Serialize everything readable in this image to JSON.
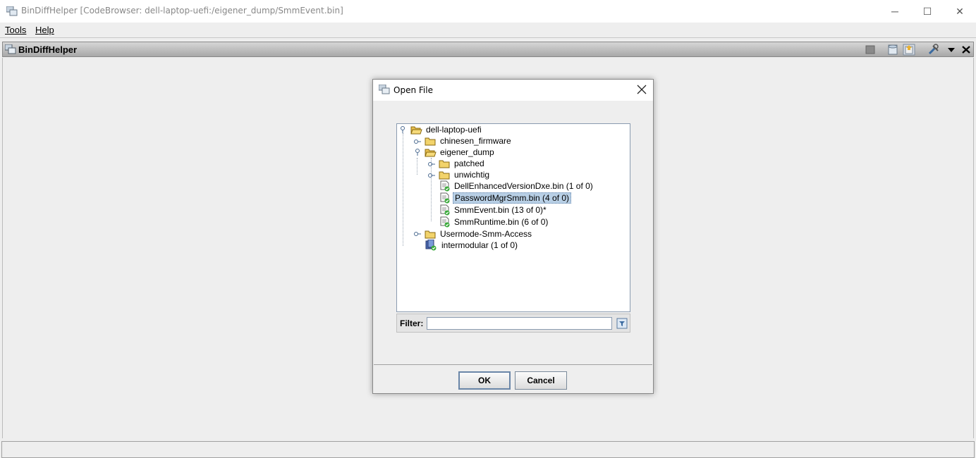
{
  "window": {
    "title": "BinDiffHelper [CodeBrowser: dell-laptop-uefi:/eigener_dump/SmmEvent.bin]",
    "controls": {
      "minimize": "─",
      "maximize": "☐",
      "close": "✕"
    }
  },
  "menubar": {
    "items": [
      {
        "label": "Tools"
      },
      {
        "label": "Help"
      }
    ]
  },
  "panel": {
    "title": "BinDiffHelper",
    "toolbar_icons": [
      "stop-icon",
      "database-icon",
      "open-file-icon",
      "tools-icon",
      "dropdown-arrow-icon",
      "close-icon"
    ]
  },
  "dialog": {
    "title": "Open File",
    "tree": {
      "root": "dell-laptop-uefi",
      "nodes": [
        {
          "label": "chinesen_firmware",
          "type": "folder"
        },
        {
          "label": "eigener_dump",
          "type": "folder-open"
        },
        {
          "label": "patched",
          "type": "folder"
        },
        {
          "label": "unwichtig",
          "type": "folder"
        },
        {
          "label": "DellEnhancedVersionDxe.bin (1 of 0)",
          "type": "file"
        },
        {
          "label": "PasswordMgrSmm.bin (4 of 0)",
          "type": "file",
          "selected": true
        },
        {
          "label": "SmmEvent.bin (13 of 0)*",
          "type": "file"
        },
        {
          "label": "SmmRuntime.bin (6 of 0)",
          "type": "file"
        },
        {
          "label": "Usermode-Smm-Access",
          "type": "folder"
        },
        {
          "label": "intermodular (1 of 0)",
          "type": "linked"
        }
      ]
    },
    "filter": {
      "label": "Filter:",
      "value": "",
      "placeholder": ""
    },
    "buttons": {
      "ok": "OK",
      "cancel": "Cancel"
    }
  },
  "colors": {
    "selection": "#b8cfe5",
    "folder": "#f2d36b",
    "check": "#3aaa3a"
  }
}
